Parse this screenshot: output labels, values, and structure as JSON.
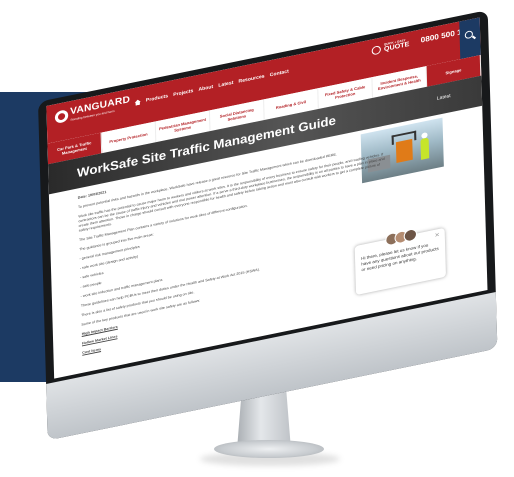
{
  "header": {
    "logo_text": "VANGUARD",
    "logo_tagline": "Standing between you and harm",
    "nav": [
      "Products",
      "Projects",
      "About",
      "Latest",
      "Resources",
      "Contact"
    ],
    "quote_small": "QUICK + EASY",
    "quote_big": "QUOTE",
    "phone": "0800 500 147"
  },
  "subnav": [
    "Car Park & Traffic Management",
    "Property Protection",
    "Pedestrian Management Systems",
    "Social Distancing Solutions",
    "Roading & Civil",
    "Fixed Safety & Cable Protection",
    "Incident Response, Environment & Health",
    "Signage"
  ],
  "hero": {
    "title": "WorkSafe Site Traffic Management Guide",
    "latest": "Latest"
  },
  "article": {
    "date": "Date: 19/03/2021",
    "intro": "To prevent potential risks and hazards in the workplace, WorkSafe have release a great resource for Site Traffic Management which can be downloaded HERE.",
    "para1": "Work site traffic has the potential to cause major harm to workers and visitors at work sites. It is the responsibility of every business to ensure safety for their people, and roading vehicles. If contractors can be the cause of traffic injury and vehicles and mot power attention. If a serve a third-duty workplace businesses, the responsibility is on all parties to have a plan in place and create them attention. Those in charge should consult with everyone responsible for health and safety before taking action and most also consult with workers to get a complete picture of safety requirements.",
    "para2": "The Site Traffic Management Plan contains a variety of solutions for work sites of different configuration.",
    "para3": "The guidance is grouped into five main areas:",
    "bullets": [
      "- general risk management principles",
      "- safe work site (design and activity)",
      "- safe vehicles",
      "- safe people",
      "- work site induction and traffic management plans"
    ],
    "para4": "These guidelines can help PCBUs to meet their duties under the Health and Safety at Work Act 2015 (HSWA).",
    "para5": "There is also a list of safety products that you should be using on site.",
    "para6": "Some of the key products that are used in work site safety are as follows:",
    "links": [
      "High Impact Barriers",
      "Hollow Market Lines",
      "Cost Items"
    ]
  },
  "chat": {
    "message": "Hi there, please let us know if you have any questions about our products or need pricing on anything."
  },
  "colors": {
    "brand_red": "#b32025",
    "navy": "#1c3a63"
  }
}
